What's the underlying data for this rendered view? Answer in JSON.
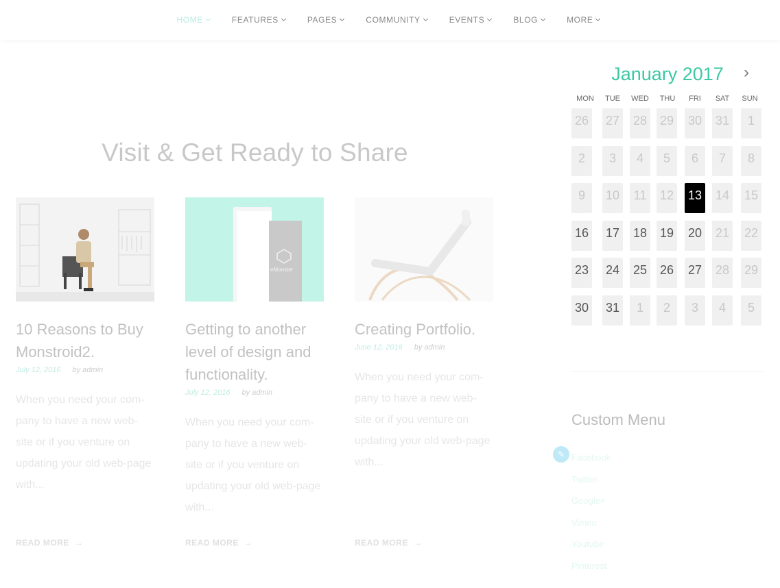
{
  "nav": {
    "items": [
      {
        "label": "HOME",
        "active": true
      },
      {
        "label": "FEATURES"
      },
      {
        "label": "PAGES"
      },
      {
        "label": "COMMUNITY"
      },
      {
        "label": "EVENTS"
      },
      {
        "label": "BLOG"
      },
      {
        "label": "MORE"
      }
    ]
  },
  "section": {
    "title": "Visit & Get Ready to Share"
  },
  "posts": [
    {
      "title": "10 Reasons to Buy Monstroid2.",
      "date": "July 12, 2016",
      "author": "by admin",
      "excerpt": "When you need your com-pany to have a new web-site or if you venture on updating your old web-page with...",
      "read_more": "READ MORE"
    },
    {
      "title": "Getting to another level of design and functionality.",
      "date": "July 12, 2016",
      "author": "by admin",
      "excerpt": "When you need your com-pany to have a new web-site or if you venture on updating your old web-page with...",
      "read_more": "READ MORE",
      "thumb_text": "eMonster"
    },
    {
      "title": "Creating Portfolio.",
      "date": "June 12, 2016",
      "author": "by admin",
      "excerpt": "When you need your com-pany to have a new web-site or if you venture on updating your old web-page with...",
      "read_more": "READ MORE"
    }
  ],
  "calendar": {
    "title": "January 2017",
    "next_icon": "chevron-right-icon",
    "weekdays": [
      "MON",
      "TUE",
      "WED",
      "THU",
      "FRI",
      "SAT",
      "SUN"
    ],
    "weeks": [
      [
        "26",
        "27",
        "28",
        "29",
        "30",
        "31",
        "1"
      ],
      [
        "2",
        "3",
        "4",
        "5",
        "6",
        "7",
        "8"
      ],
      [
        "9",
        "10",
        "11",
        "12",
        "13",
        "14",
        "15"
      ],
      [
        "16",
        "17",
        "18",
        "19",
        "20",
        "21",
        "22"
      ],
      [
        "23",
        "24",
        "25",
        "26",
        "27",
        "28",
        "29"
      ],
      [
        "30",
        "31",
        "1",
        "2",
        "3",
        "4",
        "5"
      ]
    ],
    "today": "13"
  },
  "custom_menu": {
    "title": "Custom Menu",
    "items": [
      "Facebook",
      "Twitter",
      "Google+",
      "Vimeo",
      "Youtube",
      "Pinterest"
    ]
  },
  "colors": {
    "accent": "#3bc8a2",
    "today_bg": "#000000"
  }
}
